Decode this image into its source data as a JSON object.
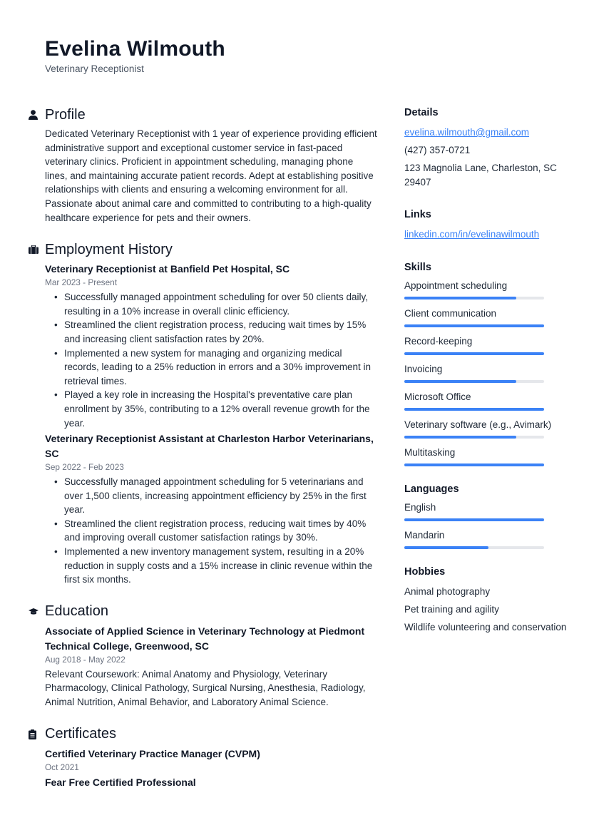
{
  "header": {
    "name": "Evelina Wilmouth",
    "role": "Veterinary Receptionist"
  },
  "profile": {
    "title": "Profile",
    "icon": "person-icon",
    "text": "Dedicated Veterinary Receptionist with 1 year of experience providing efficient administrative support and exceptional customer service in fast-paced veterinary clinics. Proficient in appointment scheduling, managing phone lines, and maintaining accurate patient records. Adept at establishing positive relationships with clients and ensuring a welcoming environment for all. Passionate about animal care and committed to contributing to a high-quality healthcare experience for pets and their owners."
  },
  "employment": {
    "title": "Employment History",
    "icon": "briefcase-icon",
    "jobs": [
      {
        "title": "Veterinary Receptionist at Banfield Pet Hospital, SC",
        "dates": "Mar 2023 - Present",
        "bullets": [
          "Successfully managed appointment scheduling for over 50 clients daily, resulting in a 10% increase in overall clinic efficiency.",
          "Streamlined the client registration process, reducing wait times by 15% and increasing client satisfaction rates by 20%.",
          "Implemented a new system for managing and organizing medical records, leading to a 25% reduction in errors and a 30% improvement in retrieval times.",
          "Played a key role in increasing the Hospital's preventative care plan enrollment by 35%, contributing to a 12% overall revenue growth for the year."
        ]
      },
      {
        "title": "Veterinary Receptionist Assistant at Charleston Harbor Veterinarians, SC",
        "dates": "Sep 2022 - Feb 2023",
        "bullets": [
          "Successfully managed appointment scheduling for 5 veterinarians and over 1,500 clients, increasing appointment efficiency by 25% in the first year.",
          "Streamlined the client registration process, reducing wait times by 40% and improving overall customer satisfaction ratings by 30%.",
          "Implemented a new inventory management system, resulting in a 20% reduction in supply costs and a 15% increase in clinic revenue within the first six months."
        ]
      }
    ]
  },
  "education": {
    "title": "Education",
    "icon": "graduation-cap-icon",
    "entries": [
      {
        "title": "Associate of Applied Science in Veterinary Technology at Piedmont Technical College, Greenwood, SC",
        "dates": "Aug 2018 - May 2022",
        "text": "Relevant Coursework: Animal Anatomy and Physiology, Veterinary Pharmacology, Clinical Pathology, Surgical Nursing, Anesthesia, Radiology, Animal Nutrition, Animal Behavior, and Laboratory Animal Science."
      }
    ]
  },
  "certificates": {
    "title": "Certificates",
    "icon": "clipboard-icon",
    "entries": [
      {
        "title": "Certified Veterinary Practice Manager (CVPM)",
        "dates": "Oct 2021"
      },
      {
        "title": "Fear Free Certified Professional"
      }
    ]
  },
  "details": {
    "title": "Details",
    "email": "evelina.wilmouth@gmail.com",
    "phone": "(427) 357-0721",
    "address": "123 Magnolia Lane, Charleston, SC 29407"
  },
  "links": {
    "title": "Links",
    "items": [
      "linkedin.com/in/evelinawilmouth"
    ]
  },
  "skills": {
    "title": "Skills",
    "accent_color": "#3b82f6",
    "track_color": "#e5e7eb",
    "items": [
      {
        "label": "Appointment scheduling",
        "level": 0.8
      },
      {
        "label": "Client communication",
        "level": 1.0
      },
      {
        "label": "Record-keeping",
        "level": 1.0
      },
      {
        "label": "Invoicing",
        "level": 0.8
      },
      {
        "label": "Microsoft Office",
        "level": 1.0
      },
      {
        "label": "Veterinary software (e.g., Avimark)",
        "level": 0.8
      },
      {
        "label": "Multitasking",
        "level": 1.0
      }
    ]
  },
  "languages": {
    "title": "Languages",
    "items": [
      {
        "label": "English",
        "level": 1.0
      },
      {
        "label": "Mandarin",
        "level": 0.6
      }
    ]
  },
  "hobbies": {
    "title": "Hobbies",
    "items": [
      "Animal photography",
      "Pet training and agility",
      "Wildlife volunteering and conservation"
    ]
  }
}
